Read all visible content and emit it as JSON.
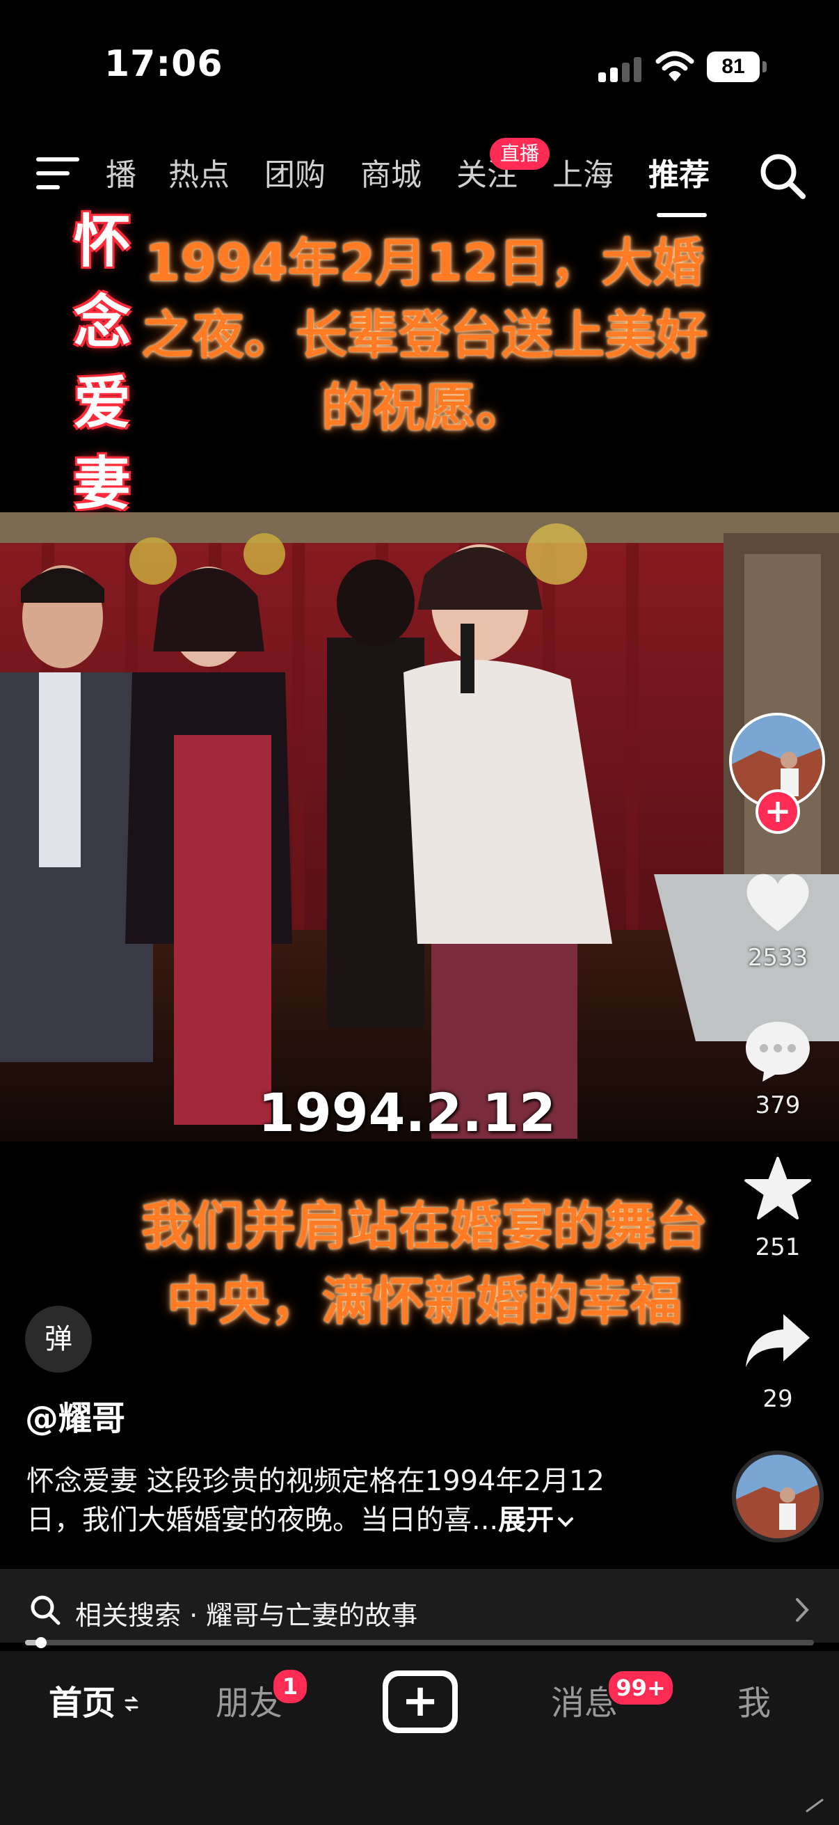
{
  "status_bar": {
    "time": "17:06",
    "battery": "81",
    "icons": [
      "signal-icon",
      "wifi-icon",
      "battery-icon"
    ]
  },
  "top_tabs": {
    "menu_icon": "menu-icon",
    "items": [
      {
        "label": "播"
      },
      {
        "label": "热点"
      },
      {
        "label": "团购"
      },
      {
        "label": "商城"
      },
      {
        "label": "关注"
      },
      {
        "label": "上海"
      },
      {
        "label": "推荐"
      }
    ],
    "live_badge": "直播",
    "active": "推荐",
    "search_icon": "search-icon"
  },
  "overlay": {
    "side_title": "怀念爱妻",
    "caption_top": "1994年2月12日，大婚之夜。长辈登台送上美好的祝愿。",
    "video_date": "1994.2.12",
    "caption_bottom": "我们并肩站在婚宴的舞台中央，满怀新婚的幸福"
  },
  "actions": {
    "follow": "+",
    "likes": "2533",
    "comments": "379",
    "favorites": "251",
    "shares": "29"
  },
  "author": {
    "danmaku_label": "弹",
    "handle": "@耀哥"
  },
  "description": {
    "line1": "怀念爱妻 这段珍贵的视频定格在1994年2月12",
    "line2": "日，我们大婚婚宴的夜晚。当日的喜...",
    "expand": "展开"
  },
  "related_search": {
    "label": "相关搜索 · 耀哥与亡妻的故事"
  },
  "progress": {
    "fraction": 0.02
  },
  "bottom_nav": {
    "home": "首页",
    "friends": "朋友",
    "friends_badge": "1",
    "post": "+",
    "messages": "消息",
    "messages_badge": "99+",
    "me": "我"
  },
  "colors": {
    "accent": "#fe2c55",
    "caption": "#ff7b24",
    "side_title_outline": "#ff2a3a"
  }
}
